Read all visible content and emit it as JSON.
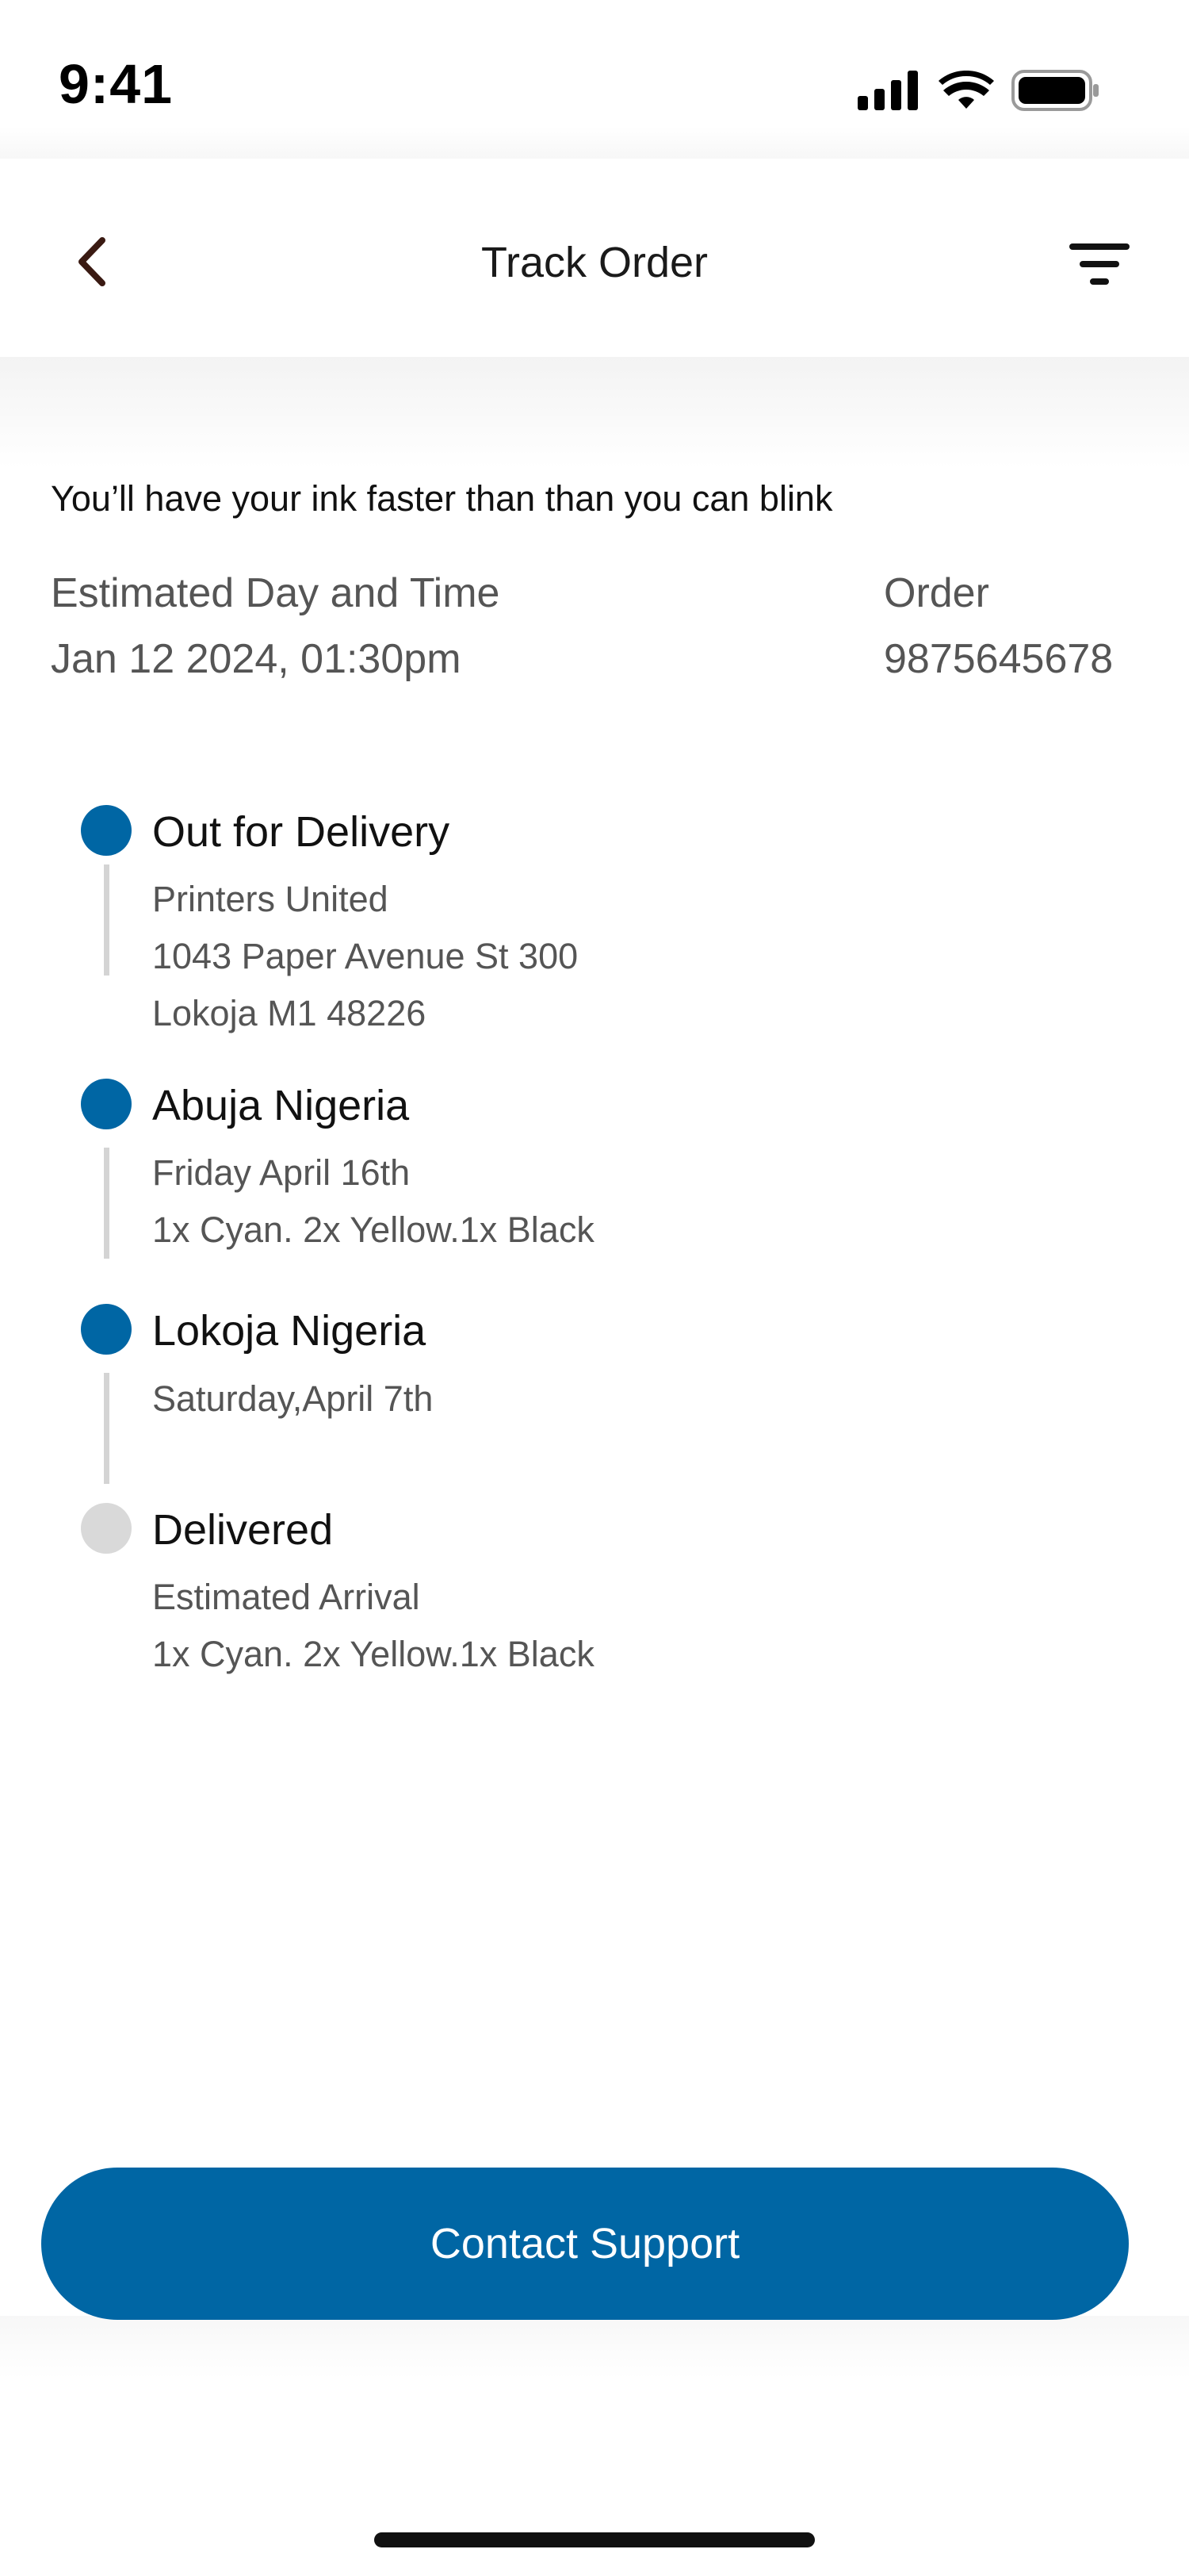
{
  "status_bar": {
    "time": "9:41",
    "icons": [
      "signal-icon",
      "wifi-icon",
      "battery-icon"
    ]
  },
  "header": {
    "title": "Track Order",
    "back_icon": "chevron-left-icon",
    "filter_icon": "filter-icon"
  },
  "info": {
    "tagline": "You’ll have your ink faster than than you can blink",
    "estimated_label": "Estimated Day and Time",
    "estimated_value": "Jan 12 2024, 01:30pm",
    "order_label": "Order",
    "order_value": "9875645678"
  },
  "timeline": [
    {
      "title": "Out for Delivery",
      "status": "done",
      "lines": [
        "Printers United",
        "1043 Paper Avenue St 300",
        "Lokoja M1 48226"
      ]
    },
    {
      "title": "Abuja Nigeria",
      "status": "done",
      "lines": [
        "Friday April 16th",
        "1x Cyan. 2x Yellow.1x Black"
      ]
    },
    {
      "title": "Lokoja Nigeria",
      "status": "done",
      "lines": [
        "Saturday,April 7th"
      ]
    },
    {
      "title": "Delivered",
      "status": "pending",
      "lines": [
        "Estimated Arrival",
        "1x Cyan. 2x Yellow.1x Black"
      ]
    }
  ],
  "actions": {
    "contact_support": "Contact Support"
  },
  "colors": {
    "primary": "#0066a4",
    "pending": "#d9d9d9",
    "text_secondary": "#555555"
  }
}
